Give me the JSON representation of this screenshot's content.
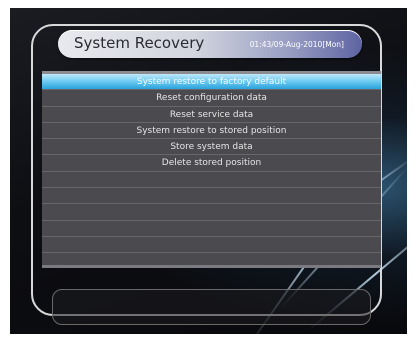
{
  "header": {
    "title": "System Recovery",
    "datetime": "01:43/09-Aug-2010[Mon]"
  },
  "menu": {
    "items": [
      {
        "label": "System restore to factory default",
        "selected": true
      },
      {
        "label": "Reset configuration data",
        "selected": false
      },
      {
        "label": "Reset service data",
        "selected": false
      },
      {
        "label": "System restore to stored position",
        "selected": false
      },
      {
        "label": "Store system data",
        "selected": false
      },
      {
        "label": "Delete stored position",
        "selected": false
      }
    ]
  },
  "colors": {
    "selected_row": "#6cc9f0",
    "menu_background": "#4a4a4f",
    "screen_background": "#0d0e12"
  }
}
